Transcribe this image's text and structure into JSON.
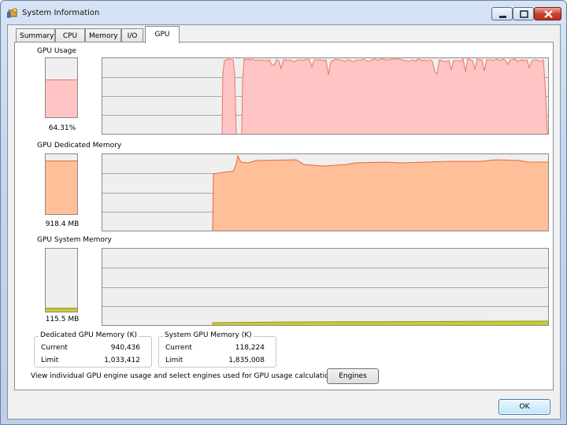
{
  "window": {
    "title": "System Information"
  },
  "tabs": [
    {
      "label": "Summary",
      "active": false
    },
    {
      "label": "CPU",
      "active": false
    },
    {
      "label": "Memory",
      "active": false
    },
    {
      "label": "I/O",
      "active": false
    },
    {
      "label": "GPU",
      "active": true
    }
  ],
  "sections": {
    "gpu_usage": {
      "label": "GPU Usage",
      "value": "64.31%",
      "level_fraction": 0.6431
    },
    "dedicated_memory": {
      "label": "GPU Dedicated Memory",
      "value": "918.4 MB",
      "level_fraction": 0.89
    },
    "system_memory": {
      "label": "GPU System Memory",
      "value": "115.5 MB",
      "level_fraction": 0.063
    }
  },
  "dedicated_box": {
    "title": "Dedicated GPU Memory (K)",
    "current_label": "Current",
    "current_value": "940,436",
    "limit_label": "Limit",
    "limit_value": "1,033,412"
  },
  "system_box": {
    "title": "System GPU Memory (K)",
    "current_label": "Current",
    "current_value": "118,224",
    "limit_label": "Limit",
    "limit_value": "1,835,008"
  },
  "engines": {
    "description": "View individual GPU engine usage and select engines used for GPU usage calculations:",
    "button_label": "Engines"
  },
  "ok_label": "OK",
  "colors": {
    "usage_fill": "#ffc4c4",
    "usage_line": "#e9775f",
    "dedicated_fill": "#ffbf99",
    "dedicated_line": "#e2683c",
    "system_fill": "#c8c838",
    "system_line": "#9a9a1e",
    "graph_bg": "#efefef",
    "grid": "#a8a8a8"
  }
}
